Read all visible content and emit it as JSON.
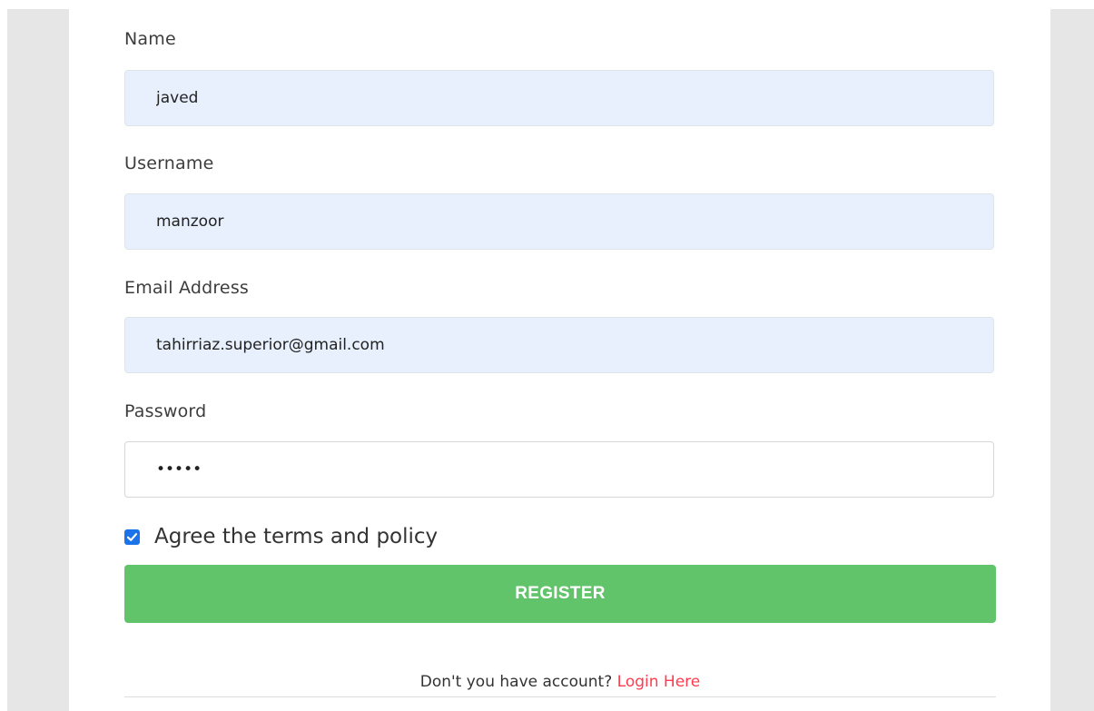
{
  "form": {
    "name": {
      "label": "Name",
      "value": "javed"
    },
    "username": {
      "label": "Username",
      "value": "manzoor"
    },
    "email": {
      "label": "Email Address",
      "value": "tahirriaz.superior@gmail.com"
    },
    "password": {
      "label": "Password",
      "value": "•••••"
    },
    "agree": {
      "label": "Agree the terms and policy",
      "checked": true
    },
    "register_label": "REGISTER"
  },
  "footer": {
    "prompt": "Don't you have account?",
    "link_label": "Login Here"
  },
  "colors": {
    "autofill_bg": "#e8f0fe",
    "register_button": "#62c46a",
    "link": "#ff3b4e",
    "checkbox": "#1a73e8",
    "gutter": "#e6e6e6"
  }
}
